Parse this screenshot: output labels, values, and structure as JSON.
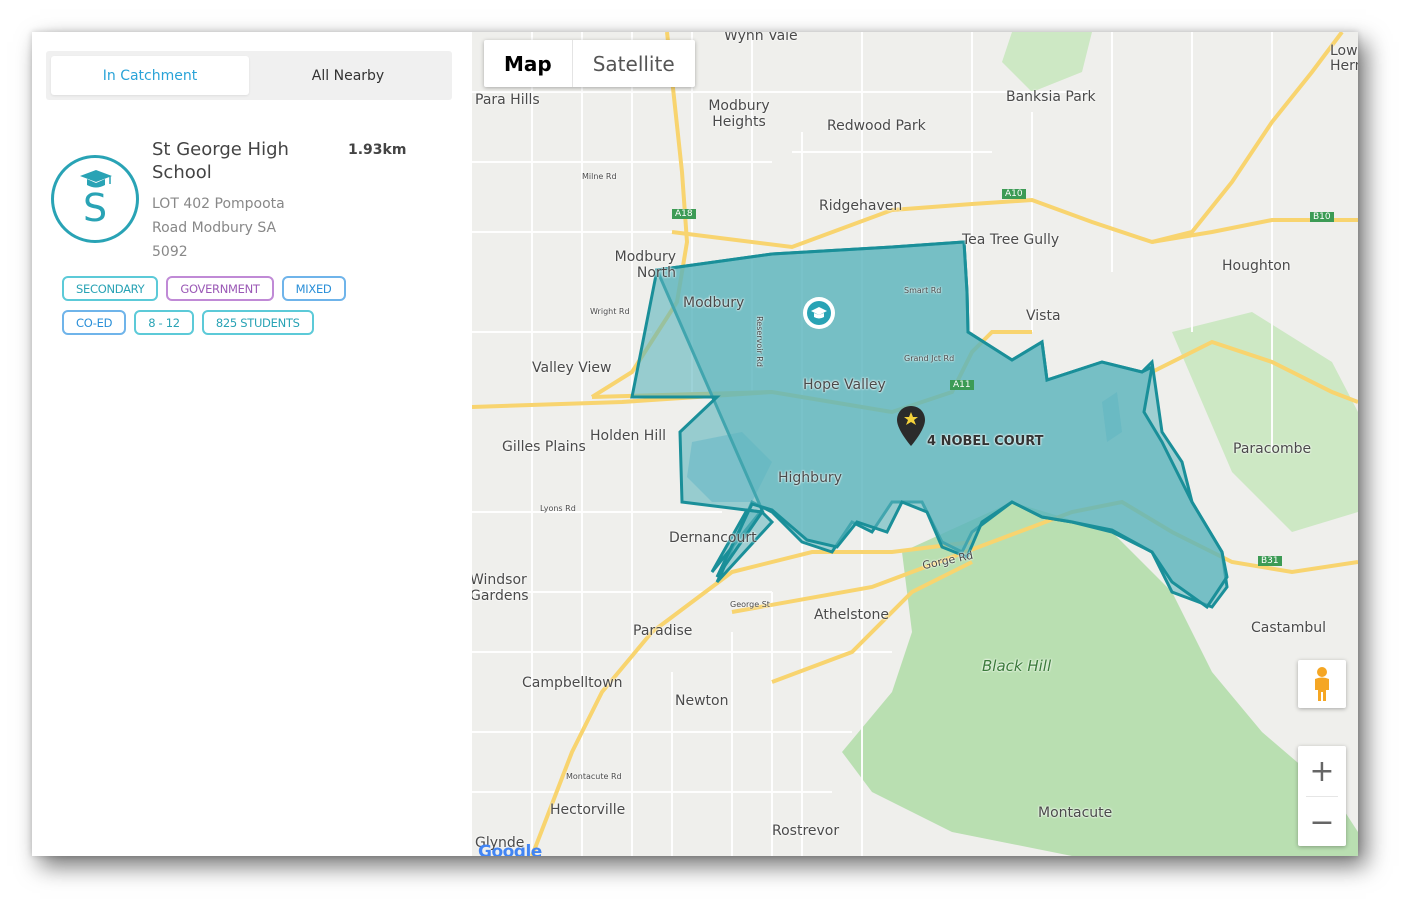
{
  "tabs": [
    {
      "label": "In Catchment",
      "active": true
    },
    {
      "label": "All Nearby",
      "active": false
    }
  ],
  "school": {
    "name": "St George High School",
    "distance": "1.93km",
    "address": "LOT 402 Pompoota Road Modbury SA 5092",
    "logo_letter": "S",
    "logo_icon": "graduation-cap-icon",
    "tags": [
      {
        "label": "SECONDARY",
        "color": "#29a3b5"
      },
      {
        "label": "GOVERNMENT",
        "color": "#9b59b6"
      },
      {
        "label": "MIXED",
        "color": "#2a8fd8"
      },
      {
        "label": "CO-ED",
        "color": "#2a8fd8"
      },
      {
        "label": "8 - 12",
        "color": "#29a3b5"
      },
      {
        "label": "825 STUDENTS",
        "color": "#29a3b5"
      }
    ]
  },
  "map": {
    "type_controls": [
      {
        "label": "Map",
        "active": true
      },
      {
        "label": "Satellite",
        "active": false
      }
    ],
    "address_marker_label": "4 NOBEL COURT",
    "catchment_color": "#1a8f99",
    "places": [
      "Wynn Vale",
      "Para Hills",
      "Modbury Heights",
      "Redwood Park",
      "Banksia Park",
      "Ridgehaven",
      "Tea Tree Gully",
      "Houghton",
      "Modbury North",
      "Modbury",
      "Vista",
      "Valley View",
      "Hope Valley",
      "Paracombe",
      "Gilles Plains",
      "Holden Hill",
      "Highbury",
      "Dernancourt",
      "Windsor Gardens",
      "Athelstone",
      "Castambul",
      "Paradise",
      "Black Hill",
      "Campbelltown",
      "Newton",
      "Hectorville",
      "Rostrevor",
      "Montacute",
      "Glynde",
      "Lower Hermitage"
    ],
    "road_labels": [
      "A18",
      "A10",
      "B10",
      "A11",
      "B31",
      "Gorge Rd",
      "Grand Jct Rd",
      "Smart Rd",
      "Milne Rd",
      "Wright Rd",
      "Reservoir Rd",
      "Lyons Rd",
      "George St",
      "Montacute Rd"
    ],
    "zoom_in": "+",
    "zoom_out": "−",
    "google_logo": "Google"
  }
}
